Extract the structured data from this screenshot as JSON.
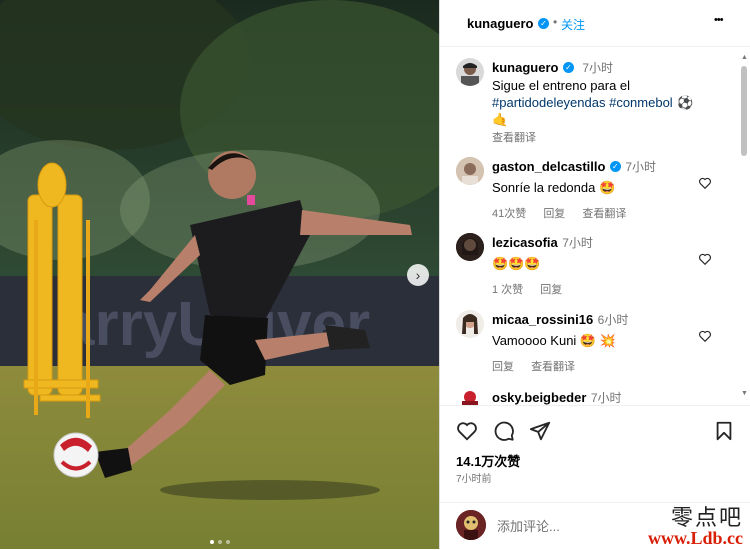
{
  "post": {
    "username": "kunaguero",
    "follow_label": "关注",
    "more_label": "•••",
    "photo_banner_text": "arryUniver"
  },
  "caption": {
    "username": "kunaguero",
    "time": "7小时",
    "text": "Sigue el entreno para el",
    "hashtags": "#partidodeleyendas #conmebol",
    "emoji": "⚽",
    "emoji2": "🤙",
    "translate": "查看翻译"
  },
  "comments": [
    {
      "username": "gaston_delcastillo",
      "verified": true,
      "time": "7小时",
      "text": "Sonríe la redonda 🤩",
      "likes": "41次赞",
      "reply": "回复",
      "translate": "查看翻译"
    },
    {
      "username": "lezicasofia",
      "verified": false,
      "time": "7小时",
      "text": "🤩🤩🤩",
      "likes": "1 次赞",
      "reply": "回复",
      "translate": ""
    },
    {
      "username": "micaa_rossini16",
      "verified": false,
      "time": "6小时",
      "text": "Vamoooo Kuni 🤩 💥",
      "likes": "",
      "reply": "回复",
      "translate": "查看翻译"
    },
    {
      "username": "osky.beigbeder",
      "verified": false,
      "time": "7小时",
      "text": "",
      "likes": "",
      "reply": "",
      "translate": ""
    }
  ],
  "stats": {
    "likes": "14.1万次赞",
    "time_ago": "7小时前"
  },
  "add_comment": {
    "placeholder": "添加评论..."
  },
  "watermark": {
    "line1": "零点吧",
    "line2": "www.Ldb.cc"
  },
  "colors": {
    "accent": "#0095f6",
    "muted": "#737373",
    "hashtag": "#00376b",
    "watermark_red": "#d81e06"
  },
  "icons": [
    "verified-icon",
    "heart-icon",
    "comment-icon",
    "share-icon",
    "bookmark-icon",
    "more-icon",
    "chevron-right-icon"
  ]
}
